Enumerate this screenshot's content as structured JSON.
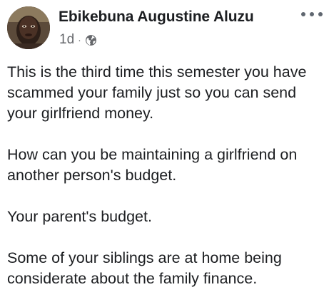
{
  "post": {
    "author": "Ebikebuna Augustine Aluzu",
    "timestamp": "1d",
    "separator": "·",
    "audience_icon": "globe-icon",
    "more_icon": "more-horizontal-icon",
    "paragraphs": [
      "This is the third time this semester you have scammed your family just so you can send your girlfriend money.",
      "How can you be maintaining a girlfriend on another person's budget.",
      "Your parent's budget.",
      "Some of your siblings are at home being considerate about the family finance."
    ]
  },
  "colors": {
    "text_primary": "#1c1e21",
    "text_secondary": "#65676b",
    "background": "#ffffff"
  }
}
